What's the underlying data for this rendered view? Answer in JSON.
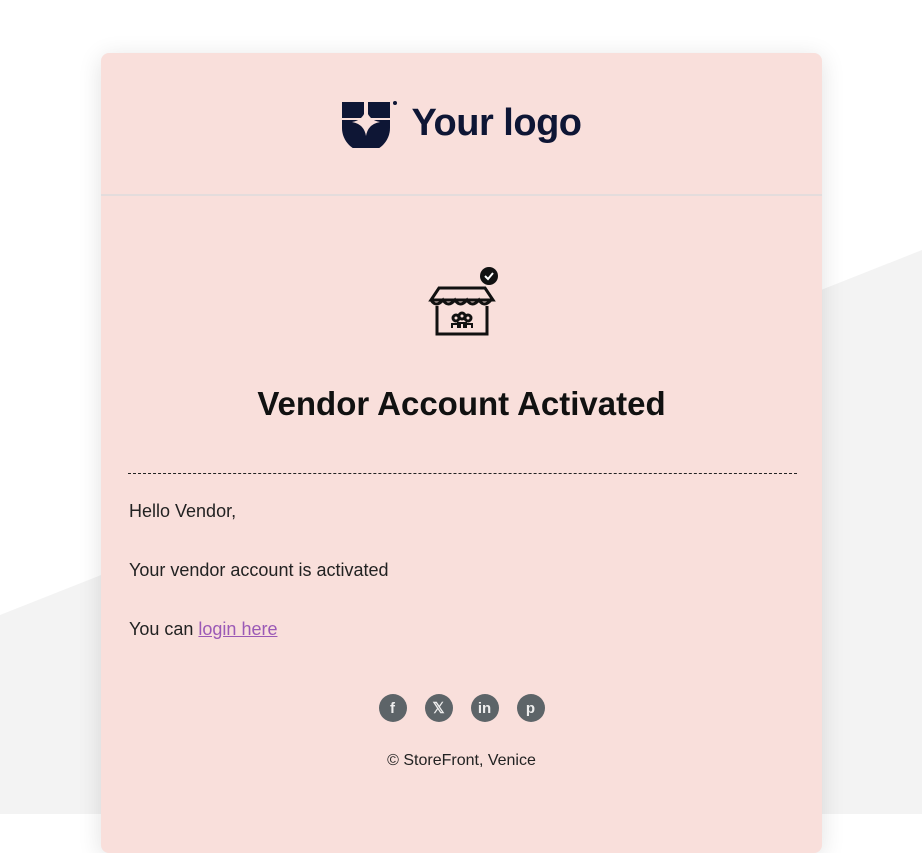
{
  "header": {
    "logo_text": "Your logo"
  },
  "hero": {
    "icon": "storefront-check-icon",
    "title": "Vendor Account Activated"
  },
  "body": {
    "greeting": "Hello Vendor,",
    "message": "Your vendor account is activated",
    "login_prefix": "You can ",
    "login_link": "login here"
  },
  "social": [
    {
      "name": "facebook",
      "glyph": "f"
    },
    {
      "name": "x",
      "glyph": "𝕏"
    },
    {
      "name": "linkedin",
      "glyph": "in"
    },
    {
      "name": "pinterest",
      "glyph": "p"
    }
  ],
  "footer": {
    "copyright": "© StoreFront, Venice"
  },
  "colors": {
    "card": "#f9dfdb",
    "brand": "#0e1635",
    "link": "#9b59b6",
    "social": "#5d6468"
  }
}
